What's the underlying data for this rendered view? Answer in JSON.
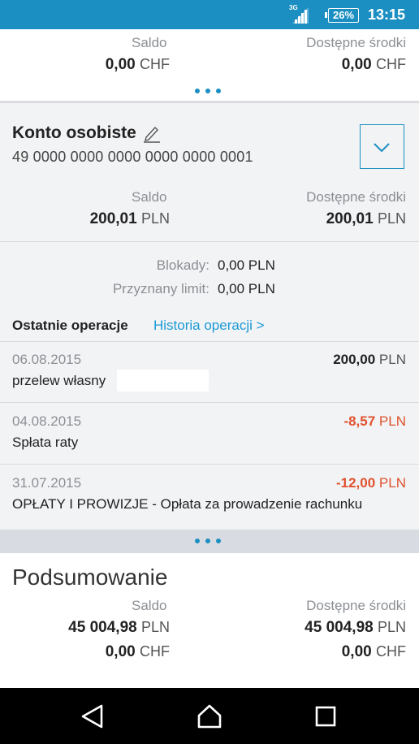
{
  "status_bar": {
    "network": "3G",
    "battery": "26%",
    "time": "13:15"
  },
  "top_card": {
    "balance_label": "Saldo",
    "balance_amount": "0,00",
    "balance_currency": "CHF",
    "available_label": "Dostępne środki",
    "available_amount": "0,00",
    "available_currency": "CHF"
  },
  "account": {
    "name": "Konto osobiste",
    "number": "49 0000 0000 0000 0000 0000 0001",
    "balance_label": "Saldo",
    "balance_amount": "200,01",
    "balance_currency": "PLN",
    "available_label": "Dostępne środki",
    "available_amount": "200,01",
    "available_currency": "PLN",
    "blocks_label": "Blokady:",
    "blocks_value": "0,00 PLN",
    "limit_label": "Przyznany limit:",
    "limit_value": "0,00 PLN",
    "recent_ops_label": "Ostatnie operacje",
    "history_link": "Historia operacji >",
    "operations": [
      {
        "date": "06.08.2015",
        "description": "przelew własny",
        "amount": "200,00",
        "currency": "PLN",
        "negative": false
      },
      {
        "date": "04.08.2015",
        "description": "Spłata raty",
        "amount": "-8,57",
        "currency": "PLN",
        "negative": true
      },
      {
        "date": "31.07.2015",
        "description": "OPŁATY I PROWIZJE - Opłata za prowadzenie rachunku",
        "amount": "-12,00",
        "currency": "PLN",
        "negative": true
      }
    ]
  },
  "summary": {
    "title": "Podsumowanie",
    "balance_label": "Saldo",
    "available_label": "Dostępne środki",
    "rows": [
      {
        "balance_amount": "45 004,98",
        "balance_currency": "PLN",
        "available_amount": "45 004,98",
        "available_currency": "PLN"
      },
      {
        "balance_amount": "0,00",
        "balance_currency": "CHF",
        "available_amount": "0,00",
        "available_currency": "CHF"
      }
    ]
  },
  "colors": {
    "accent": "#1b8fc2",
    "link": "#1b9ad6",
    "negative": "#e0522e"
  },
  "nav": {
    "back": "back-icon",
    "home": "home-icon",
    "recents": "recents-icon"
  }
}
